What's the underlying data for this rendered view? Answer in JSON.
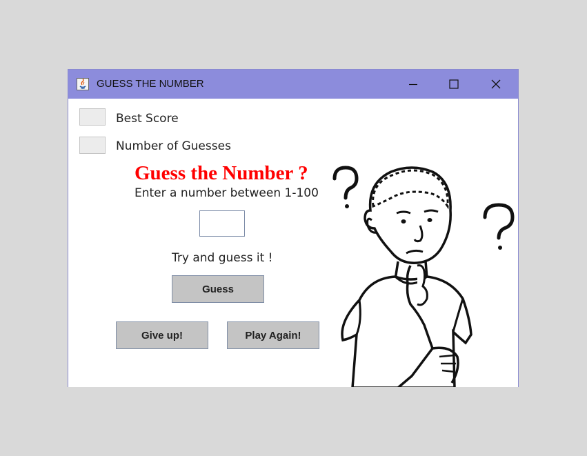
{
  "window": {
    "title": "GUESS THE NUMBER",
    "title_bar_color": "#8c8cdc",
    "icons": [
      "java-app-icon",
      "minimize-icon",
      "maximize-icon",
      "close-icon"
    ]
  },
  "stats": {
    "best_score_label": "Best Score",
    "guesses_label": "Number of Guesses"
  },
  "game": {
    "heading": "Guess the Number ?",
    "heading_color": "#ff0000",
    "instruction": "Enter a number between 1-100",
    "guess_input_value": "",
    "hint": "Try and guess it !",
    "guess_button": "Guess",
    "give_up_button": "Give up!",
    "play_again_button": "Play Again!"
  },
  "illustration": {
    "icon": "thinking-boy-illustration",
    "question_mark_left": "?",
    "question_mark_right": "?"
  }
}
